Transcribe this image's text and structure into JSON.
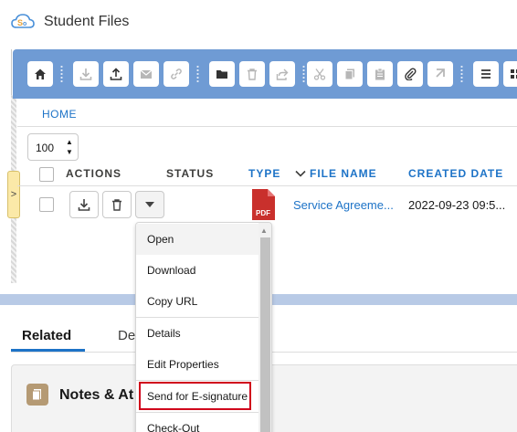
{
  "app": {
    "title": "Student Files"
  },
  "toolbar": {
    "buttons": [
      "home-icon",
      "download-icon",
      "upload-icon",
      "email-icon",
      "link-icon",
      "folder-icon",
      "delete-icon",
      "share-icon",
      "cut-icon",
      "copy-icon",
      "paste-icon",
      "attach-icon",
      "pointer-icon",
      "list-view-icon",
      "grid-view-icon"
    ]
  },
  "breadcrumb": {
    "home": "HOME"
  },
  "pagination": {
    "page_size": "100"
  },
  "table": {
    "headers": {
      "actions": "ACTIONS",
      "status": "STATUS",
      "type": "TYPE",
      "file_name": "FILE NAME",
      "created_date": "CREATED DATE"
    },
    "rows": [
      {
        "type_label": "PDF",
        "file_name": "Service Agreeme...",
        "created_date": "2022-09-23 09:5..."
      }
    ]
  },
  "menu": {
    "items": [
      "Open",
      "Download",
      "Copy URL",
      "Details",
      "Edit Properties",
      "Send for E-signature",
      "Check-Out"
    ],
    "highlighted": "Send for E-signature"
  },
  "tabs": {
    "related": "Related",
    "details": "De"
  },
  "card": {
    "title": "Notes & At"
  },
  "colors": {
    "accent": "#1d73c7",
    "toolbar": "#6f9bd4",
    "highlight": "#d0021b",
    "pdf": "#c9302c"
  }
}
